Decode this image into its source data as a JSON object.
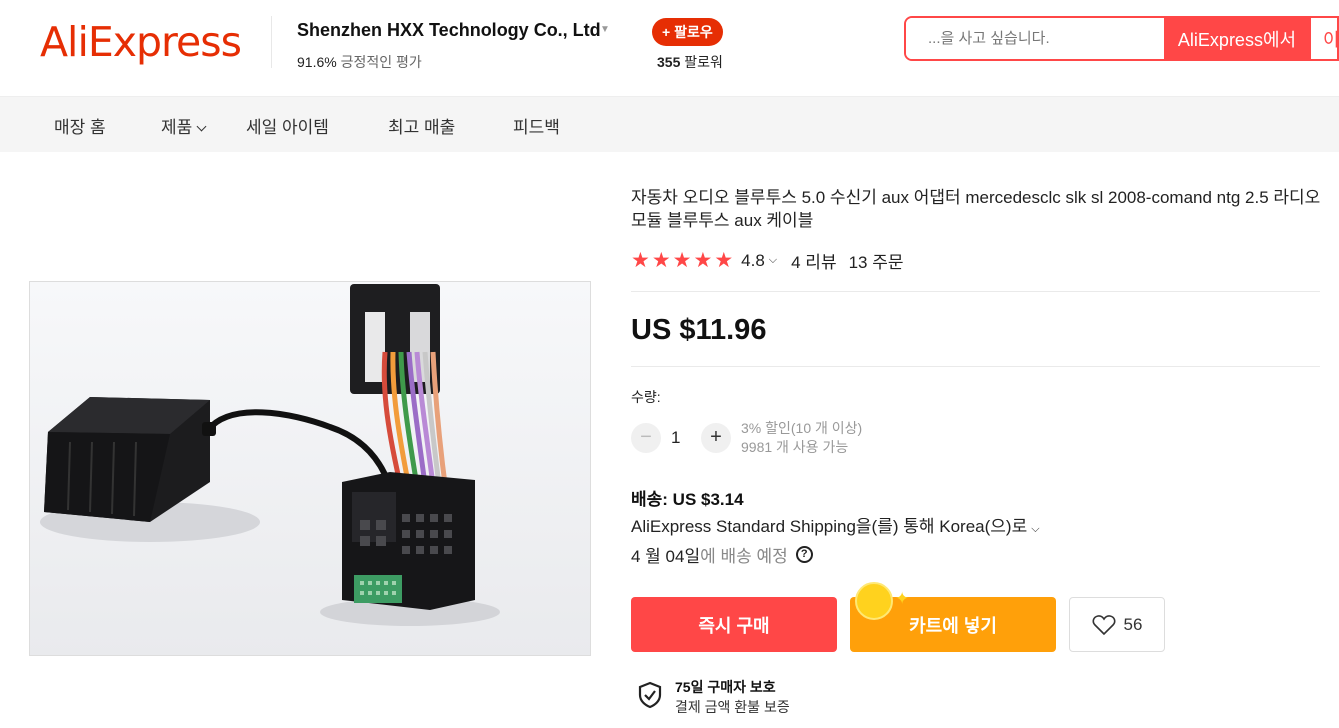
{
  "header": {
    "logo_text": "AliExpress",
    "store_name": "Shenzhen HXX Technology Co., Ltd",
    "rating_percent": "91.6%",
    "rating_label": "긍정적인 평가",
    "follow_label": "+ 팔로우",
    "follower_count": "355",
    "follower_label": "팔로워",
    "search_placeholder": "...을 사고 싶습니다.",
    "search_aliexpress_label": "AliExpress에서",
    "search_store_label": "이"
  },
  "nav": {
    "items": [
      {
        "label": "매장 홈"
      },
      {
        "label": "제품"
      },
      {
        "label": "세일 아이템"
      },
      {
        "label": "최고 매출"
      },
      {
        "label": "피드백"
      }
    ]
  },
  "product": {
    "title": "자동차 오디오 블루투스 5.0 수신기 aux 어댑터 mercedesclc slk sl 2008-comand ntg 2.5 라디오 모듈 블루투스 aux 케이블",
    "rating": "4.8",
    "reviews": "4 리뷰",
    "orders": "13 주문",
    "price": "US $11.96",
    "quantity_label": "수량:",
    "quantity": "1",
    "discount_text": "3% 할인(10 개 이상)",
    "available_text": "9981 개 사용 가능",
    "shipping_price": "배송: US $3.14",
    "shipping_method": "AliExpress Standard Shipping을(를) 통해 Korea(으)로",
    "delivery_date": "4 월 04일",
    "delivery_suffix": "에 배송 예정",
    "buy_now_label": "즉시 구매",
    "add_to_cart_label": "카트에 넣기",
    "wishlist_count": "56",
    "protection_title": "75일 구매자 보호",
    "protection_sub": "결제 금액 환불 보증"
  },
  "colors": {
    "brand": "#e62e04",
    "accent_red": "#ff4747",
    "cart_orange": "#ffa00a"
  }
}
